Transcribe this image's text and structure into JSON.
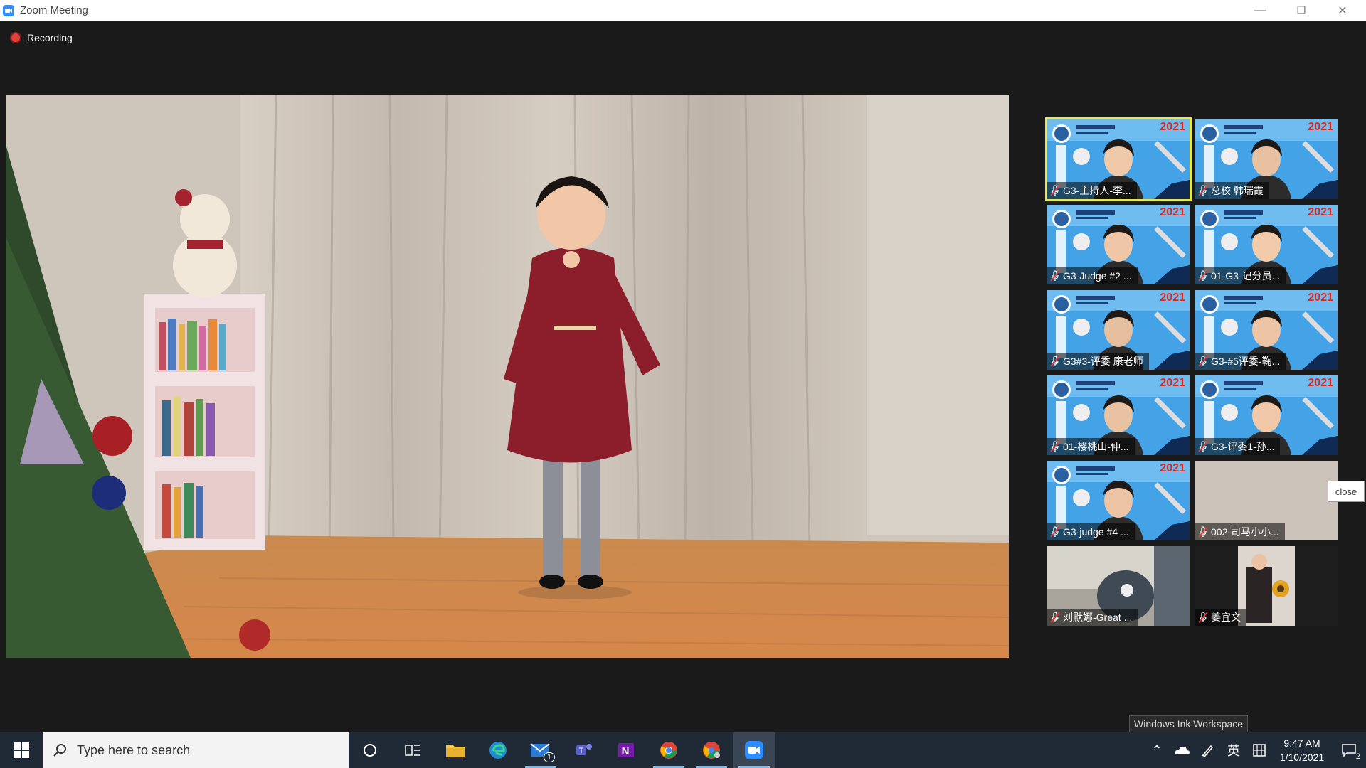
{
  "window": {
    "title": "Zoom Meeting",
    "minimize": "—",
    "restore": "❐",
    "close": "✕"
  },
  "recording": {
    "label": "Recording"
  },
  "participants": [
    {
      "name": "G3-主持人-李...",
      "active": true,
      "year": "2021"
    },
    {
      "name": "总校 韩瑞霞",
      "active": false,
      "year": "2021"
    },
    {
      "name": "G3-Judge #2 ...",
      "active": false,
      "year": "2021"
    },
    {
      "name": "01-G3-记分员...",
      "active": false,
      "year": "2021"
    },
    {
      "name": "G3#3-评委 康老师",
      "active": false,
      "year": "2021"
    },
    {
      "name": "G3-#5评委-鞠...",
      "active": false,
      "year": "2021"
    },
    {
      "name": "01-樱桃山-仲...",
      "active": false,
      "year": "2021"
    },
    {
      "name": "G3-评委1-孙...",
      "active": false,
      "year": "2021"
    },
    {
      "name": "G3-judge #4 ...",
      "active": false,
      "year": "2021"
    },
    {
      "name": "002-司马小小...",
      "active": false,
      "year": ""
    },
    {
      "name": "刘默娜-Great ...",
      "active": false,
      "year": ""
    },
    {
      "name": "姜宜文",
      "active": false,
      "year": ""
    }
  ],
  "close_tooltip": "close",
  "ink_tooltip": "Windows Ink Workspace",
  "taskbar": {
    "search_placeholder": "Type here to search",
    "mail_badge": "1",
    "lang": "英",
    "time": "9:47 AM",
    "date": "1/10/2021",
    "notif_badge": "2"
  },
  "colors": {
    "accent": "#2d8cff",
    "active_speaker": "#e6e94a",
    "recording": "#e0403a",
    "taskbar": "#1f2a36"
  }
}
